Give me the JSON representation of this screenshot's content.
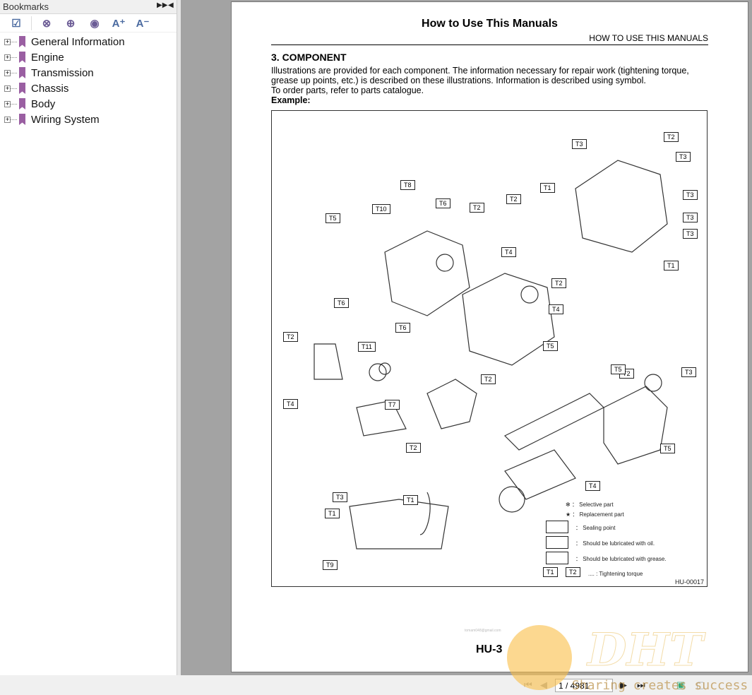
{
  "sidebar": {
    "title": "Bookmarks",
    "items": [
      {
        "label": "General Information"
      },
      {
        "label": "Engine"
      },
      {
        "label": "Transmission"
      },
      {
        "label": "Chassis"
      },
      {
        "label": "Body"
      },
      {
        "label": "Wiring System"
      }
    ]
  },
  "page": {
    "title": "How to Use This Manuals",
    "header": "HOW TO USE THIS MANUALS",
    "section": "3.  COMPONENT",
    "paragraph1": "Illustrations are provided for each component. The information necessary for repair work (tightening torque, grease up points, etc.) is described on these illustrations. Information is described using symbol.",
    "paragraph2": "To order parts, refer to parts catalogue.",
    "example": "Example:",
    "page_id": "HU-3",
    "watermark_email": "tomam048@gmail.com"
  },
  "diagram": {
    "code": "HU-00017",
    "torque_labels": [
      "T3",
      "T2",
      "T3",
      "T1",
      "T3",
      "T3",
      "T3",
      "T1",
      "T8",
      "T10",
      "T5",
      "T6",
      "T2",
      "T2",
      "T4",
      "T2",
      "T4",
      "T5",
      "T6",
      "T11",
      "T6",
      "T2",
      "T2",
      "T4",
      "T2",
      "T7",
      "T2",
      "T5",
      "T3",
      "T5",
      "T4",
      "T3",
      "T1",
      "T1",
      "T9"
    ],
    "legend": {
      "selective": "： Selective part",
      "replacement": "： Replacement part",
      "sealing": "： Sealing point",
      "oil": "： Should be lubricated with oil.",
      "grease": "： Should be lubricated with grease.",
      "t1": "T1",
      "t2": "T2",
      "torque": ".... : Tightening torque"
    }
  },
  "nav": {
    "page_input": "1 / 4981"
  },
  "watermark": {
    "logo": "DHT",
    "slogan": "Sharing creates success"
  }
}
